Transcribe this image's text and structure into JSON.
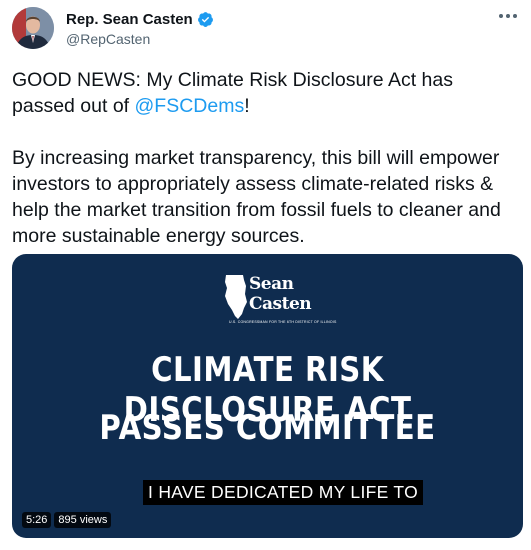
{
  "author": {
    "display_name": "Rep. Sean Casten",
    "handle": "@RepCasten",
    "avatar_icon": "portrait-avatar",
    "verified_icon": "verified-badge-icon"
  },
  "tweet": {
    "paragraph1_prefix": "GOOD NEWS: My Climate Risk Disclosure Act has passed out of ",
    "mention": "@FSCDems",
    "paragraph1_suffix": "!",
    "paragraph2": "By increasing market transparency, this bill will empower investors to appropriately assess climate-related risks & help the market transition from fossil fuels to cleaner and more sustainable energy sources."
  },
  "media": {
    "logo_line1": "Sean",
    "logo_line2": "Casten",
    "logo_subtitle": "U.S. CONGRESSMAN FOR THE 6TH DISTRICT OF ILLINOIS",
    "headline_line1": "CLIMATE RISK DISCLOSURE ACT",
    "headline_line2": "PASSES COMMITTEE",
    "caption": "I HAVE DEDICATED MY LIFE TO",
    "duration": "5:26",
    "views": "895 views"
  },
  "colors": {
    "accent": "#1d9bf0",
    "media_background": "#0f2c4f",
    "text_primary": "#0f1419",
    "text_secondary": "#536471"
  }
}
